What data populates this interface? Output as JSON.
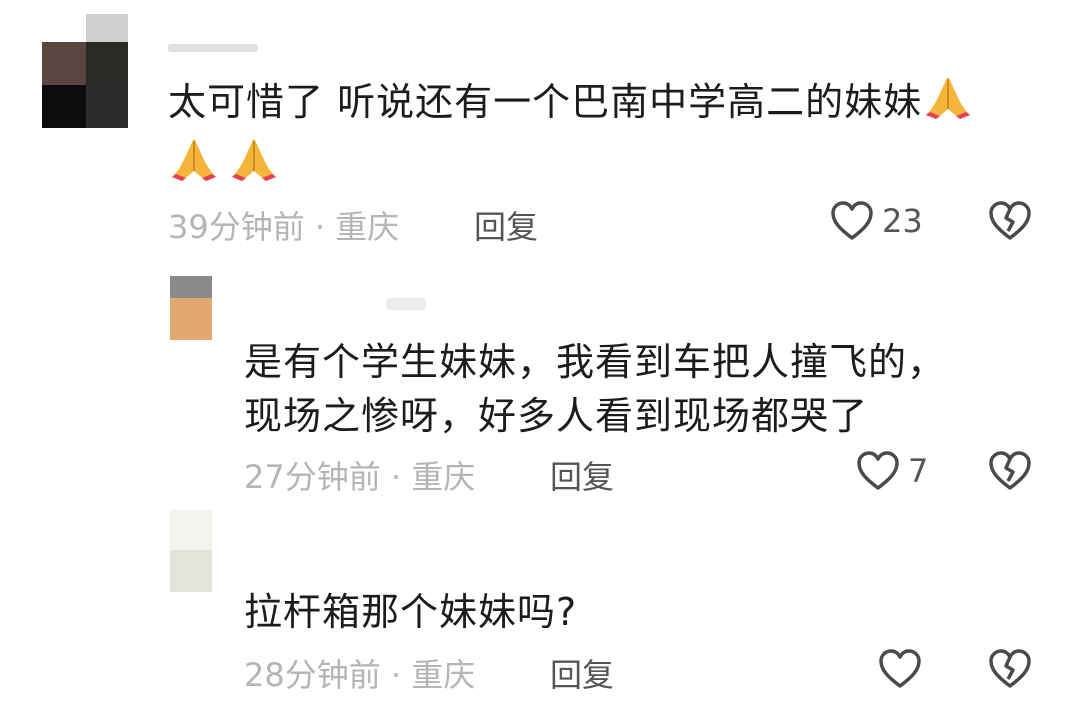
{
  "comments": [
    {
      "text_line1": "太可惜了 听说还有一个巴南中学高二的妹妹",
      "emoji_trailing": "folded-hands",
      "emoji_line2": [
        "folded-hands",
        "folded-hands"
      ],
      "time": "39分钟前",
      "location": "重庆",
      "reply_label": "回复",
      "likes": "23"
    },
    {
      "text_line1": "是有个学生妹妹，我看到车把人撞飞的，",
      "text_line2": "现场之惨呀，好多人看到现场都哭了",
      "time": "27分钟前",
      "location": "重庆",
      "reply_label": "回复",
      "likes": "7"
    },
    {
      "text_line1": "拉杆箱那个妹妹吗?",
      "time": "28分钟前",
      "location": "重庆",
      "reply_label": "回复",
      "likes": ""
    }
  ],
  "separator": "·",
  "icons": {
    "like": "heart-icon",
    "dislike": "broken-heart-icon",
    "emoji": "folded-hands-emoji"
  }
}
